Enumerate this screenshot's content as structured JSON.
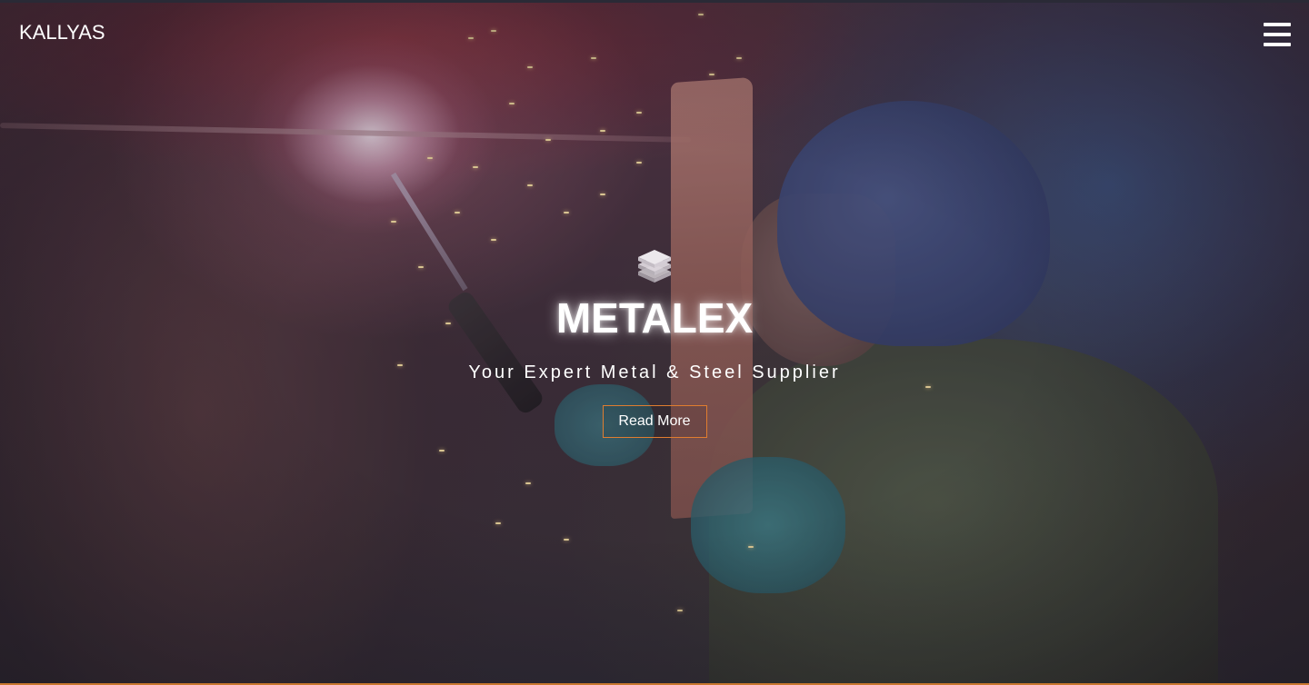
{
  "header": {
    "logo_text": "KALLYAS",
    "menu_icon": "hamburger-menu-icon"
  },
  "hero": {
    "icon": "layers-stack-icon",
    "title": "METALEX",
    "subtitle": "Your Expert Metal & Steel Supplier",
    "cta_label": "Read More"
  },
  "colors": {
    "text": "#ffffff",
    "cta_border": "#e07d2f",
    "bottom_accent": "#c9782f"
  }
}
